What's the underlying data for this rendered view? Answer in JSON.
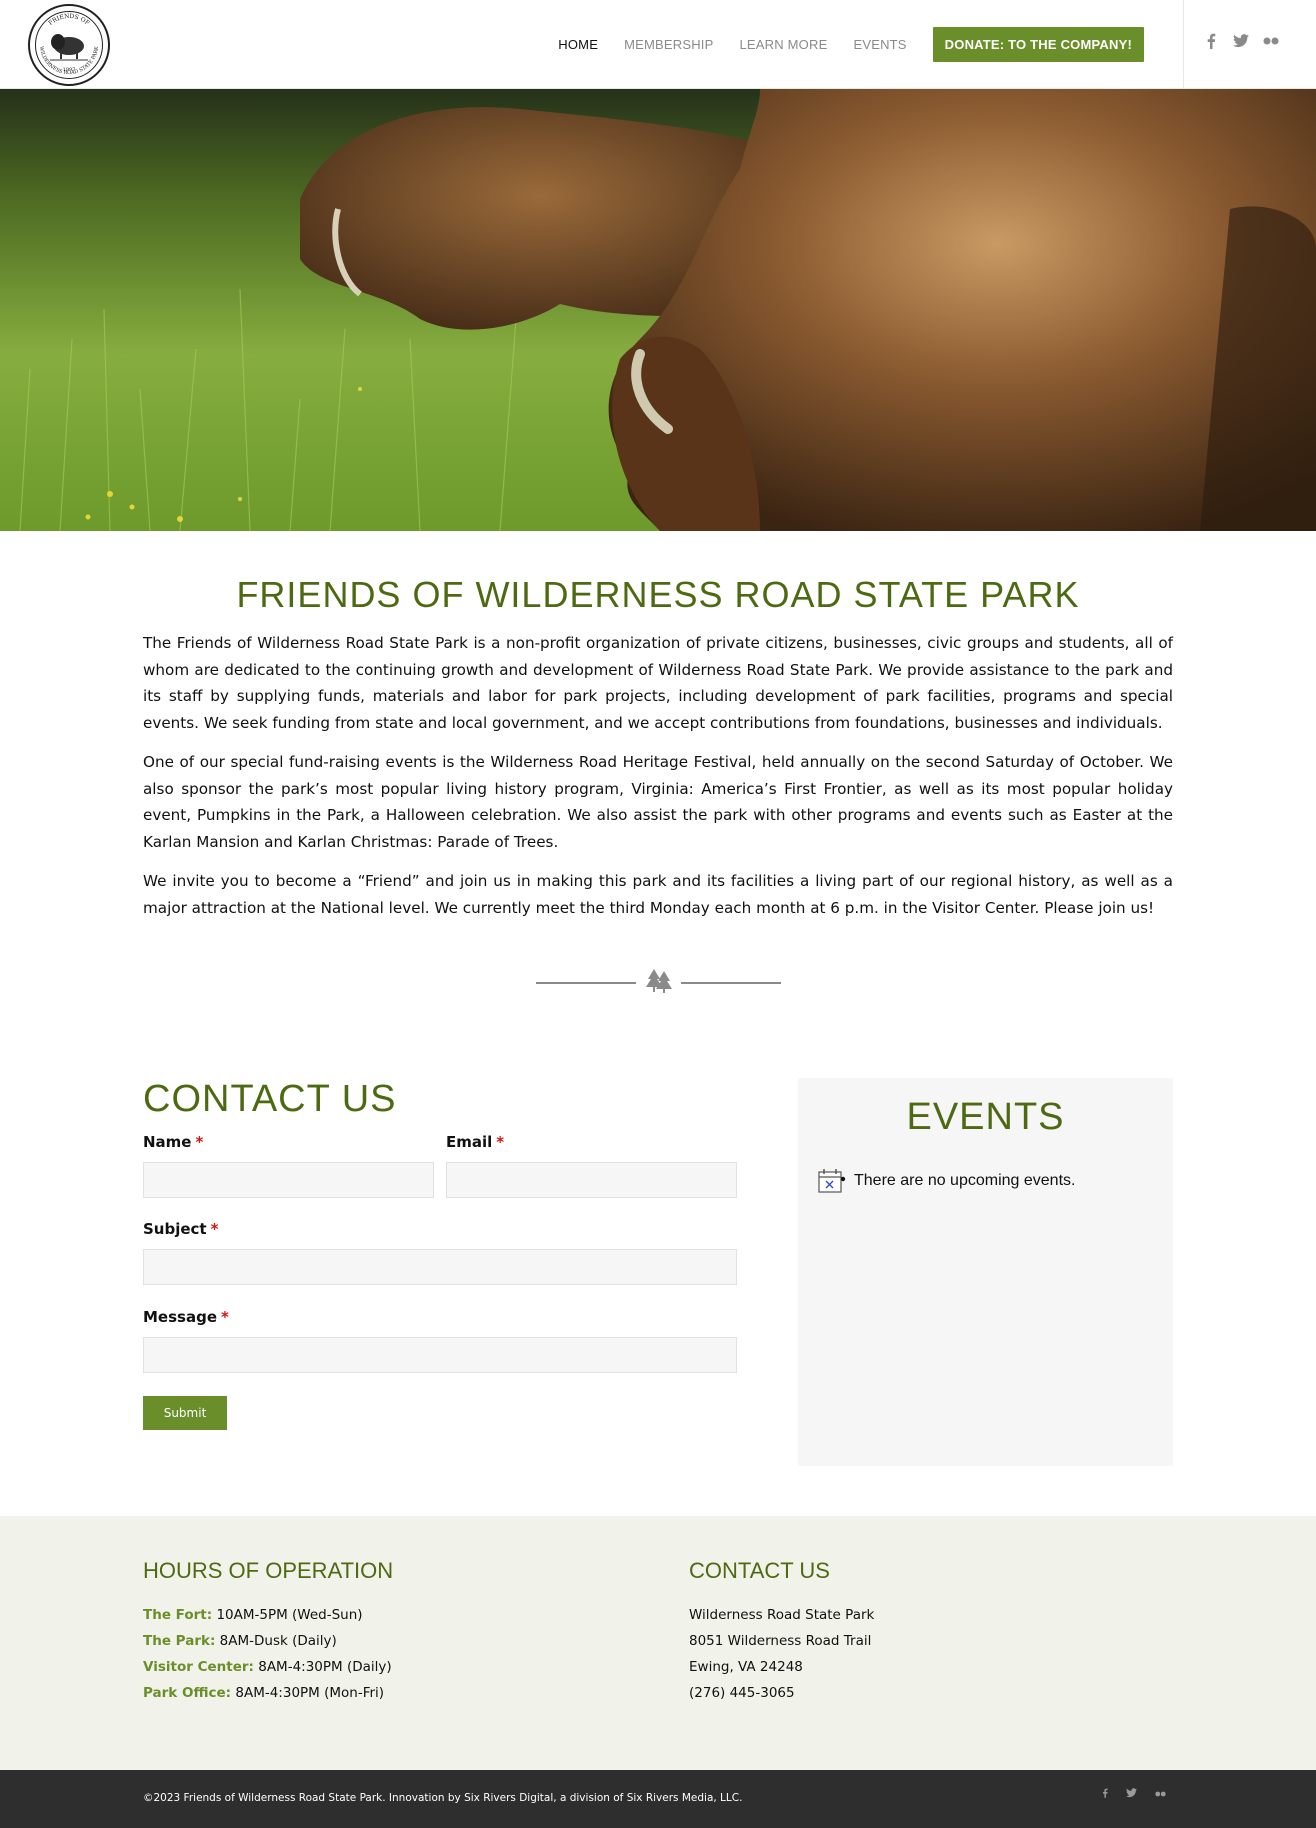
{
  "header": {
    "nav": [
      "HOME",
      "MEMBERSHIP",
      "LEARN MORE",
      "EVENTS"
    ],
    "donate_label": "DONATE: TO THE COMPANY!",
    "logo_text_top": "FRIENDS OF",
    "logo_text_bottom": "WILDERNESS ROAD STATE PARK",
    "logo_year": "1997"
  },
  "intro": {
    "title": "FRIENDS OF WILDERNESS ROAD STATE PARK",
    "p1": "The Friends of Wilderness Road State Park is a non-profit organization of private citizens, businesses, civic groups and students, all of whom are dedicated to the continuing growth and development of Wilderness Road State Park. We provide assistance to the park and its staff by supplying funds, materials and labor for park projects, including development of park facilities, programs and special events. We seek funding from state and local government, and we accept contributions from foundations, businesses and individuals.",
    "p2": "One of our special fund-raising events is the Wilderness Road Heritage Festival, held annually on the second Saturday of October. We also sponsor the park’s most popular living history program, Virginia: America’s First Frontier, as well as its most popular holiday event, Pumpkins in the Park, a Halloween celebration. We also assist the park with other programs and events such as Easter at the Karlan Mansion and Karlan Christmas: Parade of Trees.",
    "p3": "We invite you to become a “Friend” and join us in making this park and its facilities a living part of our regional history, as well as a major attraction at the National level. We currently meet the third Monday each month at 6 p.m. in the Visitor Center. Please join us!"
  },
  "contact": {
    "title": "CONTACT US",
    "name_label": "Name",
    "email_label": "Email",
    "subject_label": "Subject",
    "message_label": "Message",
    "required_mark": "*",
    "submit_label": "Submit"
  },
  "events": {
    "title": "EVENTS",
    "empty_text": "There are no upcoming events."
  },
  "footer": {
    "hours_title": "HOURS OF OPERATION",
    "hours": [
      {
        "k": "The Fort:",
        "v": "10AM-5PM (Wed-Sun)"
      },
      {
        "k": "The Park:",
        "v": "8AM-Dusk (Daily)"
      },
      {
        "k": "Visitor Center:",
        "v": "8AM-4:30PM (Daily)"
      },
      {
        "k": "Park Office:",
        "v": "8AM-4:30PM (Mon-Fri)"
      }
    ],
    "contact_title": "CONTACT US",
    "address": [
      "Wilderness Road State Park",
      "8051 Wilderness Road Trail",
      "Ewing, VA 24248",
      "(276) 445-3065"
    ]
  },
  "bottom": {
    "copyright": "©2023 Friends of Wilderness Road State Park. Innovation by Six Rivers Digital, a division of Six Rivers Media, LLC."
  },
  "colors": {
    "accent_green": "#6a8e2a",
    "title_green": "#4d6a12",
    "footer_bg": "#f1f3ea",
    "bottom_bg": "#2e2e2e"
  }
}
